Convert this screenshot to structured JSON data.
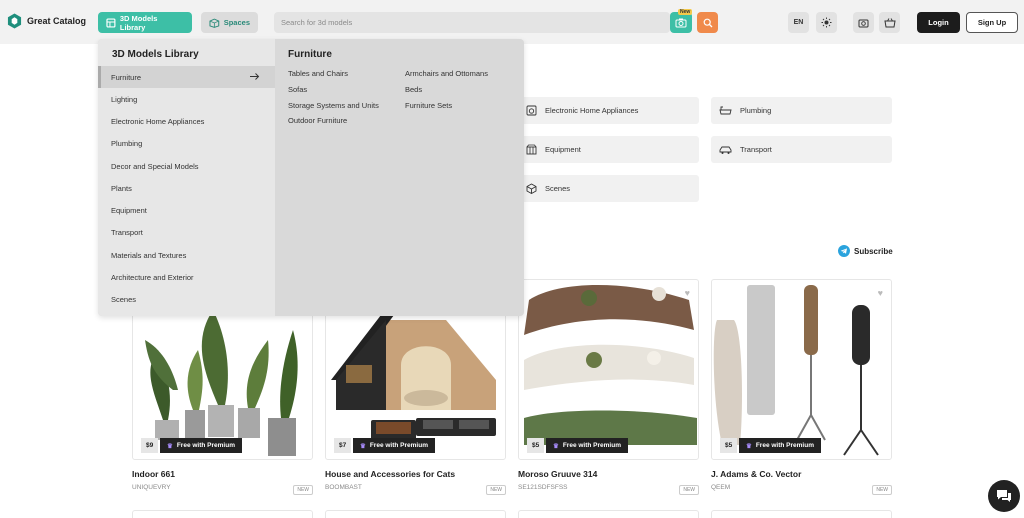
{
  "header": {
    "logo_text": "Great Catalog",
    "library_button": "3D Models Library",
    "spaces_button": "Spaces",
    "search_placeholder": "Search for 3d models",
    "new_badge": "New",
    "language": "EN",
    "login": "Login",
    "signup": "Sign Up"
  },
  "categories": [
    {
      "label": "Electronic Home Appliances",
      "icon": "appliance-icon"
    },
    {
      "label": "Plumbing",
      "icon": "bathtub-icon"
    },
    {
      "label": "Equipment",
      "icon": "equipment-icon"
    },
    {
      "label": "Transport",
      "icon": "car-icon"
    },
    {
      "label": "Scenes",
      "icon": "cube-icon"
    }
  ],
  "subscribe": "Subscribe",
  "cards": [
    {
      "title": "Indoor 661",
      "author": "UNIQUEVRY",
      "price": "$9",
      "premium": "Free with Premium",
      "badge": "NEW"
    },
    {
      "title": "House and Accessories for Cats",
      "author": "BOOMBAST",
      "price": "$7",
      "premium": "Free with Premium",
      "badge": "NEW"
    },
    {
      "title": "Moroso Gruuve 314",
      "author": "SE121SDFSFSS",
      "price": "$5",
      "premium": "Free with Premium",
      "badge": "NEW"
    },
    {
      "title": "J. Adams & Co. Vector",
      "author": "QEEM",
      "price": "$5",
      "premium": "Free with Premium",
      "badge": "NEW"
    }
  ],
  "dropdown": {
    "title": "3D Models Library",
    "items": [
      "Furniture",
      "Lighting",
      "Electronic Home Appliances",
      "Plumbing",
      "Decor and Special Models",
      "Plants",
      "Equipment",
      "Transport",
      "Materials and Textures",
      "Architecture and Exterior",
      "Scenes"
    ],
    "active_index": 0,
    "sub_title": "Furniture",
    "sub_col1": [
      "Tables and Chairs",
      "Sofas",
      "Storage Systems and Units",
      "Outdoor Furniture"
    ],
    "sub_col2": [
      "Armchairs and Ottomans",
      "Beds",
      "Furniture Sets"
    ]
  },
  "colors": {
    "accent": "#3dbfa6",
    "orange": "#f08a4b",
    "dark": "#1c1c1c"
  }
}
